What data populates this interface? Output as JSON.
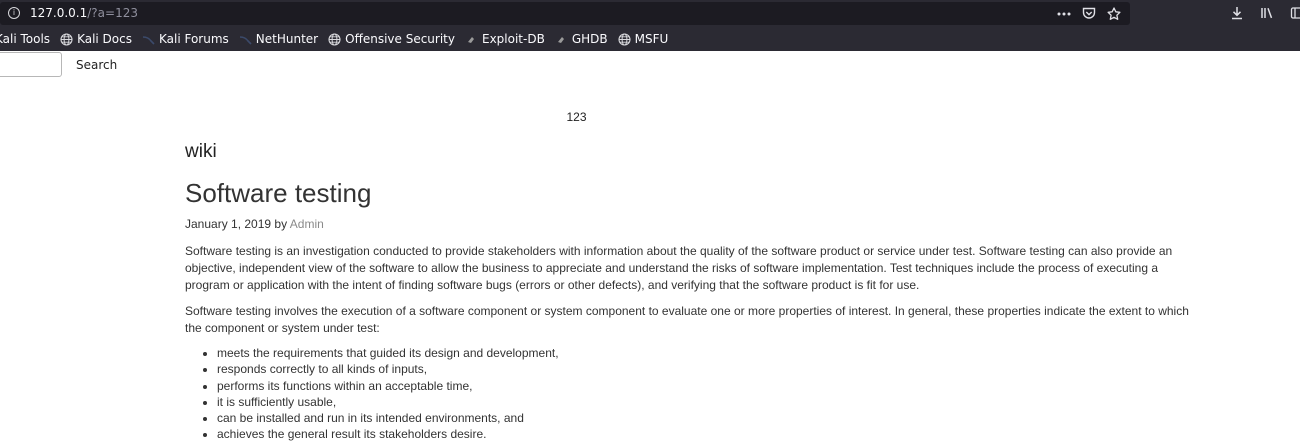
{
  "browser": {
    "url_host": "127.0.0.1",
    "url_rest": "/?a=123",
    "url_icons": [
      "more-actions-icon",
      "pocket-icon",
      "bookmark-star-icon"
    ],
    "toolbar_icons": [
      "downloads-icon",
      "library-icon",
      "sidebar-icon"
    ],
    "bookmarks": [
      {
        "label": "Kali Tools",
        "icon": "kali-icon"
      },
      {
        "label": "Kali Docs",
        "icon": "globe-icon"
      },
      {
        "label": "Kali Forums",
        "icon": "kali-icon"
      },
      {
        "label": "NetHunter",
        "icon": "kali-icon"
      },
      {
        "label": "Offensive Security",
        "icon": "globe-icon"
      },
      {
        "label": "Exploit-DB",
        "icon": "exploit-db-icon"
      },
      {
        "label": "GHDB",
        "icon": "exploit-db-icon"
      },
      {
        "label": "MSFU",
        "icon": "globe-icon"
      }
    ]
  },
  "search": {
    "value": "",
    "button_label": "Search"
  },
  "query_echo": "123",
  "site_title": "wiki",
  "post": {
    "title": "Software testing",
    "date": "January 1, 2019",
    "by": "by",
    "author": "Admin",
    "paragraphs": [
      "Software testing is an investigation conducted to provide stakeholders with information about the quality of the software product or service under test. Software testing can also provide an objective, independent view of the software to allow the business to appreciate and understand the risks of software implementation. Test techniques include the process of executing a program or application with the intent of finding software bugs (errors or other defects), and verifying that the software product is fit for use.",
      "Software testing involves the execution of a software component or system component to evaluate one or more properties of interest. In general, these properties indicate the extent to which the component or system under test:"
    ],
    "list": [
      "meets the requirements that guided its design and development,",
      "responds correctly to all kinds of inputs,",
      "performs its functions within an acceptable time,",
      "it is sufficiently usable,",
      "can be installed and run in its intended environments, and",
      "achieves the general result its stakeholders desire."
    ]
  },
  "colors": {
    "chrome_bg": "#2b2a33",
    "urlbar_bg": "#1c1b22",
    "author_link": "#8a8a8a"
  }
}
